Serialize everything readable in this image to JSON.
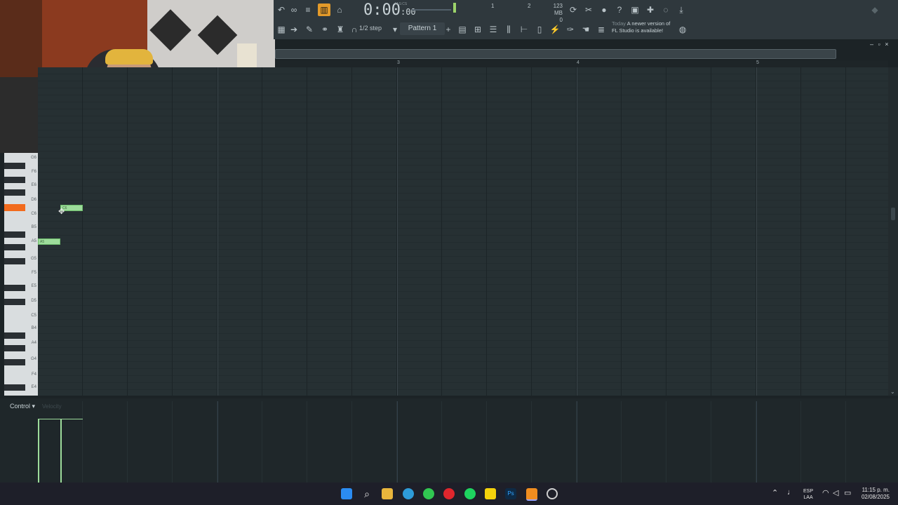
{
  "toolbar": {
    "time_main": "0:00",
    "time_sub": ":00",
    "time_unit": "M:S:CS",
    "snap": "1/2 step",
    "pattern": "Pattern 1",
    "meter_val1": "1",
    "meter_val2": "2",
    "mem_line1": "123 MB",
    "mem_line2": "0",
    "news_today": "Today",
    "news_line1": "A newer version of",
    "news_line2": "FL Studio is available!"
  },
  "ruler": {
    "bars": [
      "3",
      "4",
      "5"
    ]
  },
  "keys": {
    "labels": [
      "G6",
      "F6",
      "E6",
      "D6",
      "C6",
      "B5",
      "A5",
      "G5",
      "F5",
      "E5",
      "D5",
      "C5",
      "B4",
      "A4",
      "G4",
      "F4",
      "E4"
    ]
  },
  "notes": [
    {
      "label": "C6",
      "pitch": "C6",
      "start_step": 2
    },
    {
      "label": "A5",
      "pitch": "A5",
      "start_step": 0
    }
  ],
  "control": {
    "label": "Control",
    "param": "Velocity"
  },
  "taskbar": {
    "lang_line1": "ESP",
    "lang_line2": "LAA",
    "time": "11:15 p. m.",
    "date": "02/08/2025"
  },
  "colors": {
    "note": "#9ddc9b",
    "highlight_key": "#f26b1d",
    "active_button": "#e39a2a"
  }
}
